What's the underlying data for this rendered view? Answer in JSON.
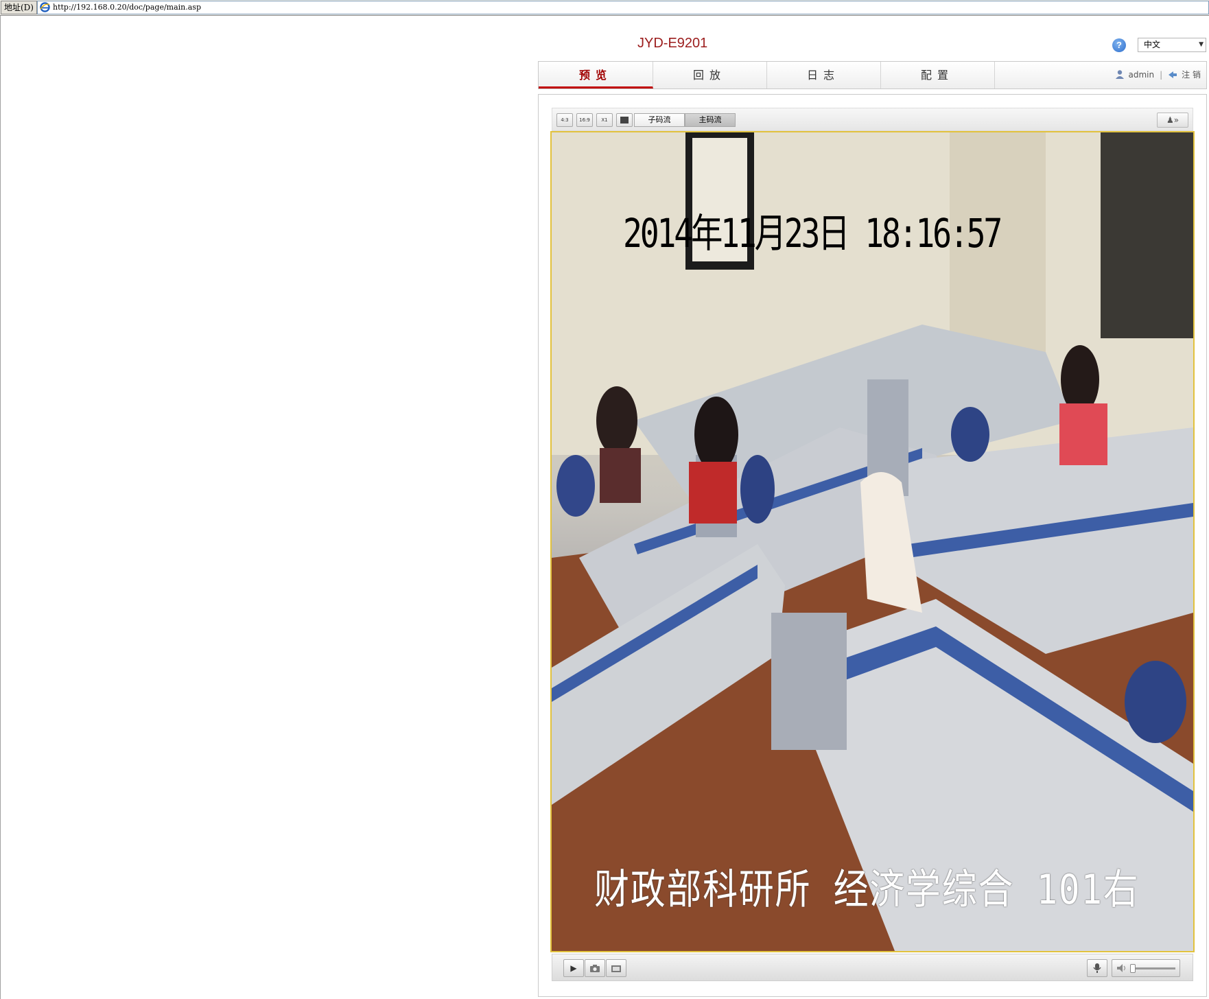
{
  "browser": {
    "address_label": "地址(D)",
    "url": "http://192.168.0.20/doc/page/main.asp"
  },
  "header": {
    "device_name": "JYD-E9201",
    "help": "?",
    "language": "中文"
  },
  "nav": {
    "tabs": [
      {
        "label": "预览",
        "active": true
      },
      {
        "label": "回放",
        "active": false
      },
      {
        "label": "日志",
        "active": false
      },
      {
        "label": "配置",
        "active": false
      }
    ],
    "user": "admin",
    "logout": "注 销"
  },
  "toolbar": {
    "ratio_4_3": "4:3",
    "ratio_16_9": "16:9",
    "ratio_x1": "X1",
    "sub_stream": "子码流",
    "main_stream": "主码流",
    "expand": "»"
  },
  "video": {
    "osd_time": "2014年11月23日  18:16:57",
    "osd_label": "财政部科研所 经济学综合  101右"
  },
  "colors": {
    "accent": "#a00000",
    "title": "#9b1c1c",
    "video_border": "#e2c23d"
  },
  "icons": [
    "ie-icon",
    "help-icon",
    "user-icon",
    "logout-icon",
    "play-icon",
    "snapshot-icon",
    "record-icon",
    "microphone-icon",
    "volume-icon",
    "ptz-icon"
  ]
}
